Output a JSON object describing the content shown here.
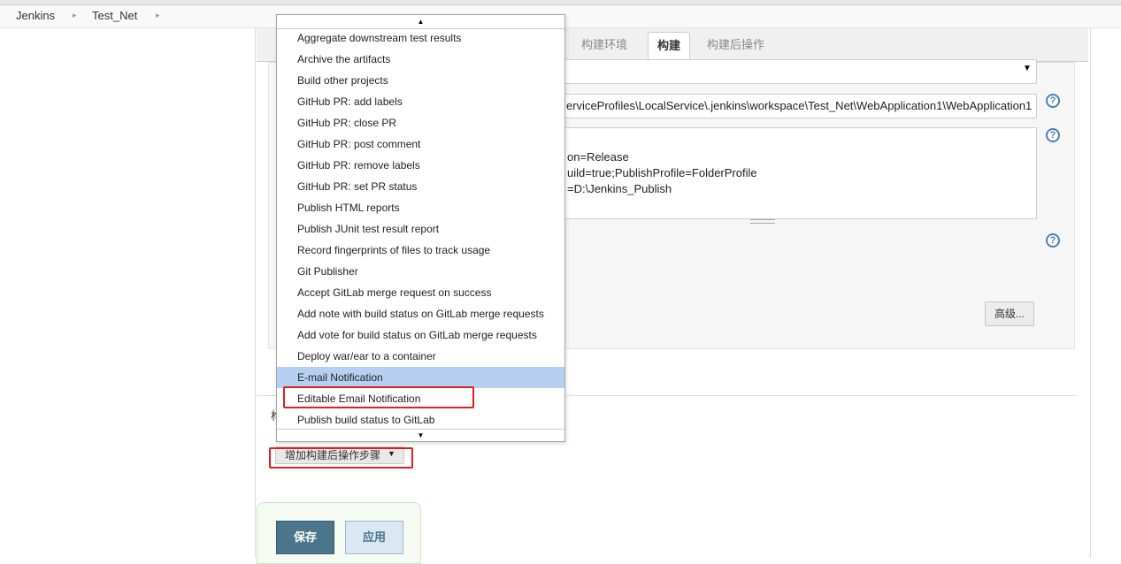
{
  "breadcrumb": {
    "root": "Jenkins",
    "project": "Test_Net",
    "sep": "▸"
  },
  "tabs": [
    {
      "label": "构建环境",
      "active": false
    },
    {
      "label": "构建",
      "active": true
    },
    {
      "label": "构建后操作",
      "active": false
    }
  ],
  "build": {
    "select_value": "",
    "path_value": "erviceProfiles\\LocalService\\.jenkins\\workspace\\Test_Net\\WebApplication1\\WebApplication1",
    "args_lines": [
      "on=Release",
      "uild=true;PublishProfile=FolderProfile",
      "=D:\\Jenkins_Publish"
    ],
    "advanced_label": "高级..."
  },
  "post_build": {
    "heading_partial": "构",
    "add_step_label": "增加构建后操作步骤"
  },
  "actions": {
    "save_label": "保存",
    "apply_label": "应用"
  },
  "menu": {
    "highlighted_index": 16,
    "boxed_index": 17,
    "items": [
      "Aggregate downstream test results",
      "Archive the artifacts",
      "Build other projects",
      "GitHub PR: add labels",
      "GitHub PR: close PR",
      "GitHub PR: post comment",
      "GitHub PR: remove labels",
      "GitHub PR: set PR status",
      "Publish HTML reports",
      "Publish JUnit test result report",
      "Record fingerprints of files to track usage",
      "Git Publisher",
      "Accept GitLab merge request on success",
      "Add note with build status on GitLab merge requests",
      "Add vote for build status on GitLab merge requests",
      "Deploy war/ear to a container",
      "E-mail Notification",
      "Editable Email Notification",
      "Publish build status to GitLab"
    ]
  },
  "icons": {
    "help": "?",
    "caret_down": "▼",
    "scroll_up": "▲",
    "scroll_down": "▼"
  },
  "colors": {
    "highlight": "#b6d0f1",
    "annotation_red": "#e02020",
    "save_button": "#4b758b"
  }
}
